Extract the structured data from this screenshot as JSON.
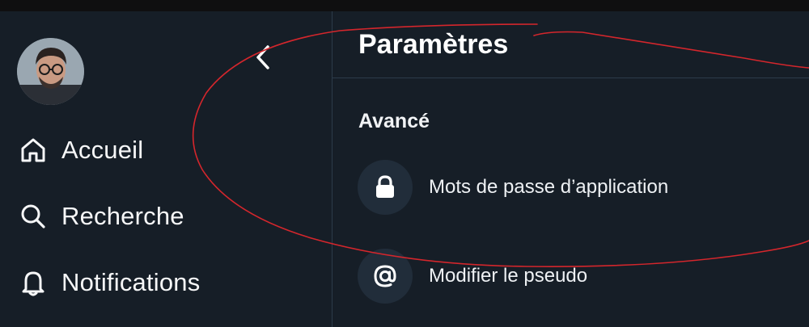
{
  "colors": {
    "background": "#161e27",
    "divider": "#2c3b4a",
    "icon_bg": "#212d3a",
    "text": "#f1f3f5",
    "annotation": "#d4262c"
  },
  "sidebar": {
    "avatar_icon": "user-avatar",
    "back_icon": "chevron-left-icon",
    "items": [
      {
        "label": "Accueil",
        "icon": "home-icon"
      },
      {
        "label": "Recherche",
        "icon": "search-icon"
      },
      {
        "label": "Notifications",
        "icon": "bell-icon"
      }
    ]
  },
  "main": {
    "title": "Paramètres",
    "section_title": "Avancé",
    "rows": [
      {
        "label": "Mots de passe d’application",
        "icon": "lock-icon"
      },
      {
        "label": "Modifier le pseudo",
        "icon": "at-icon"
      }
    ]
  }
}
